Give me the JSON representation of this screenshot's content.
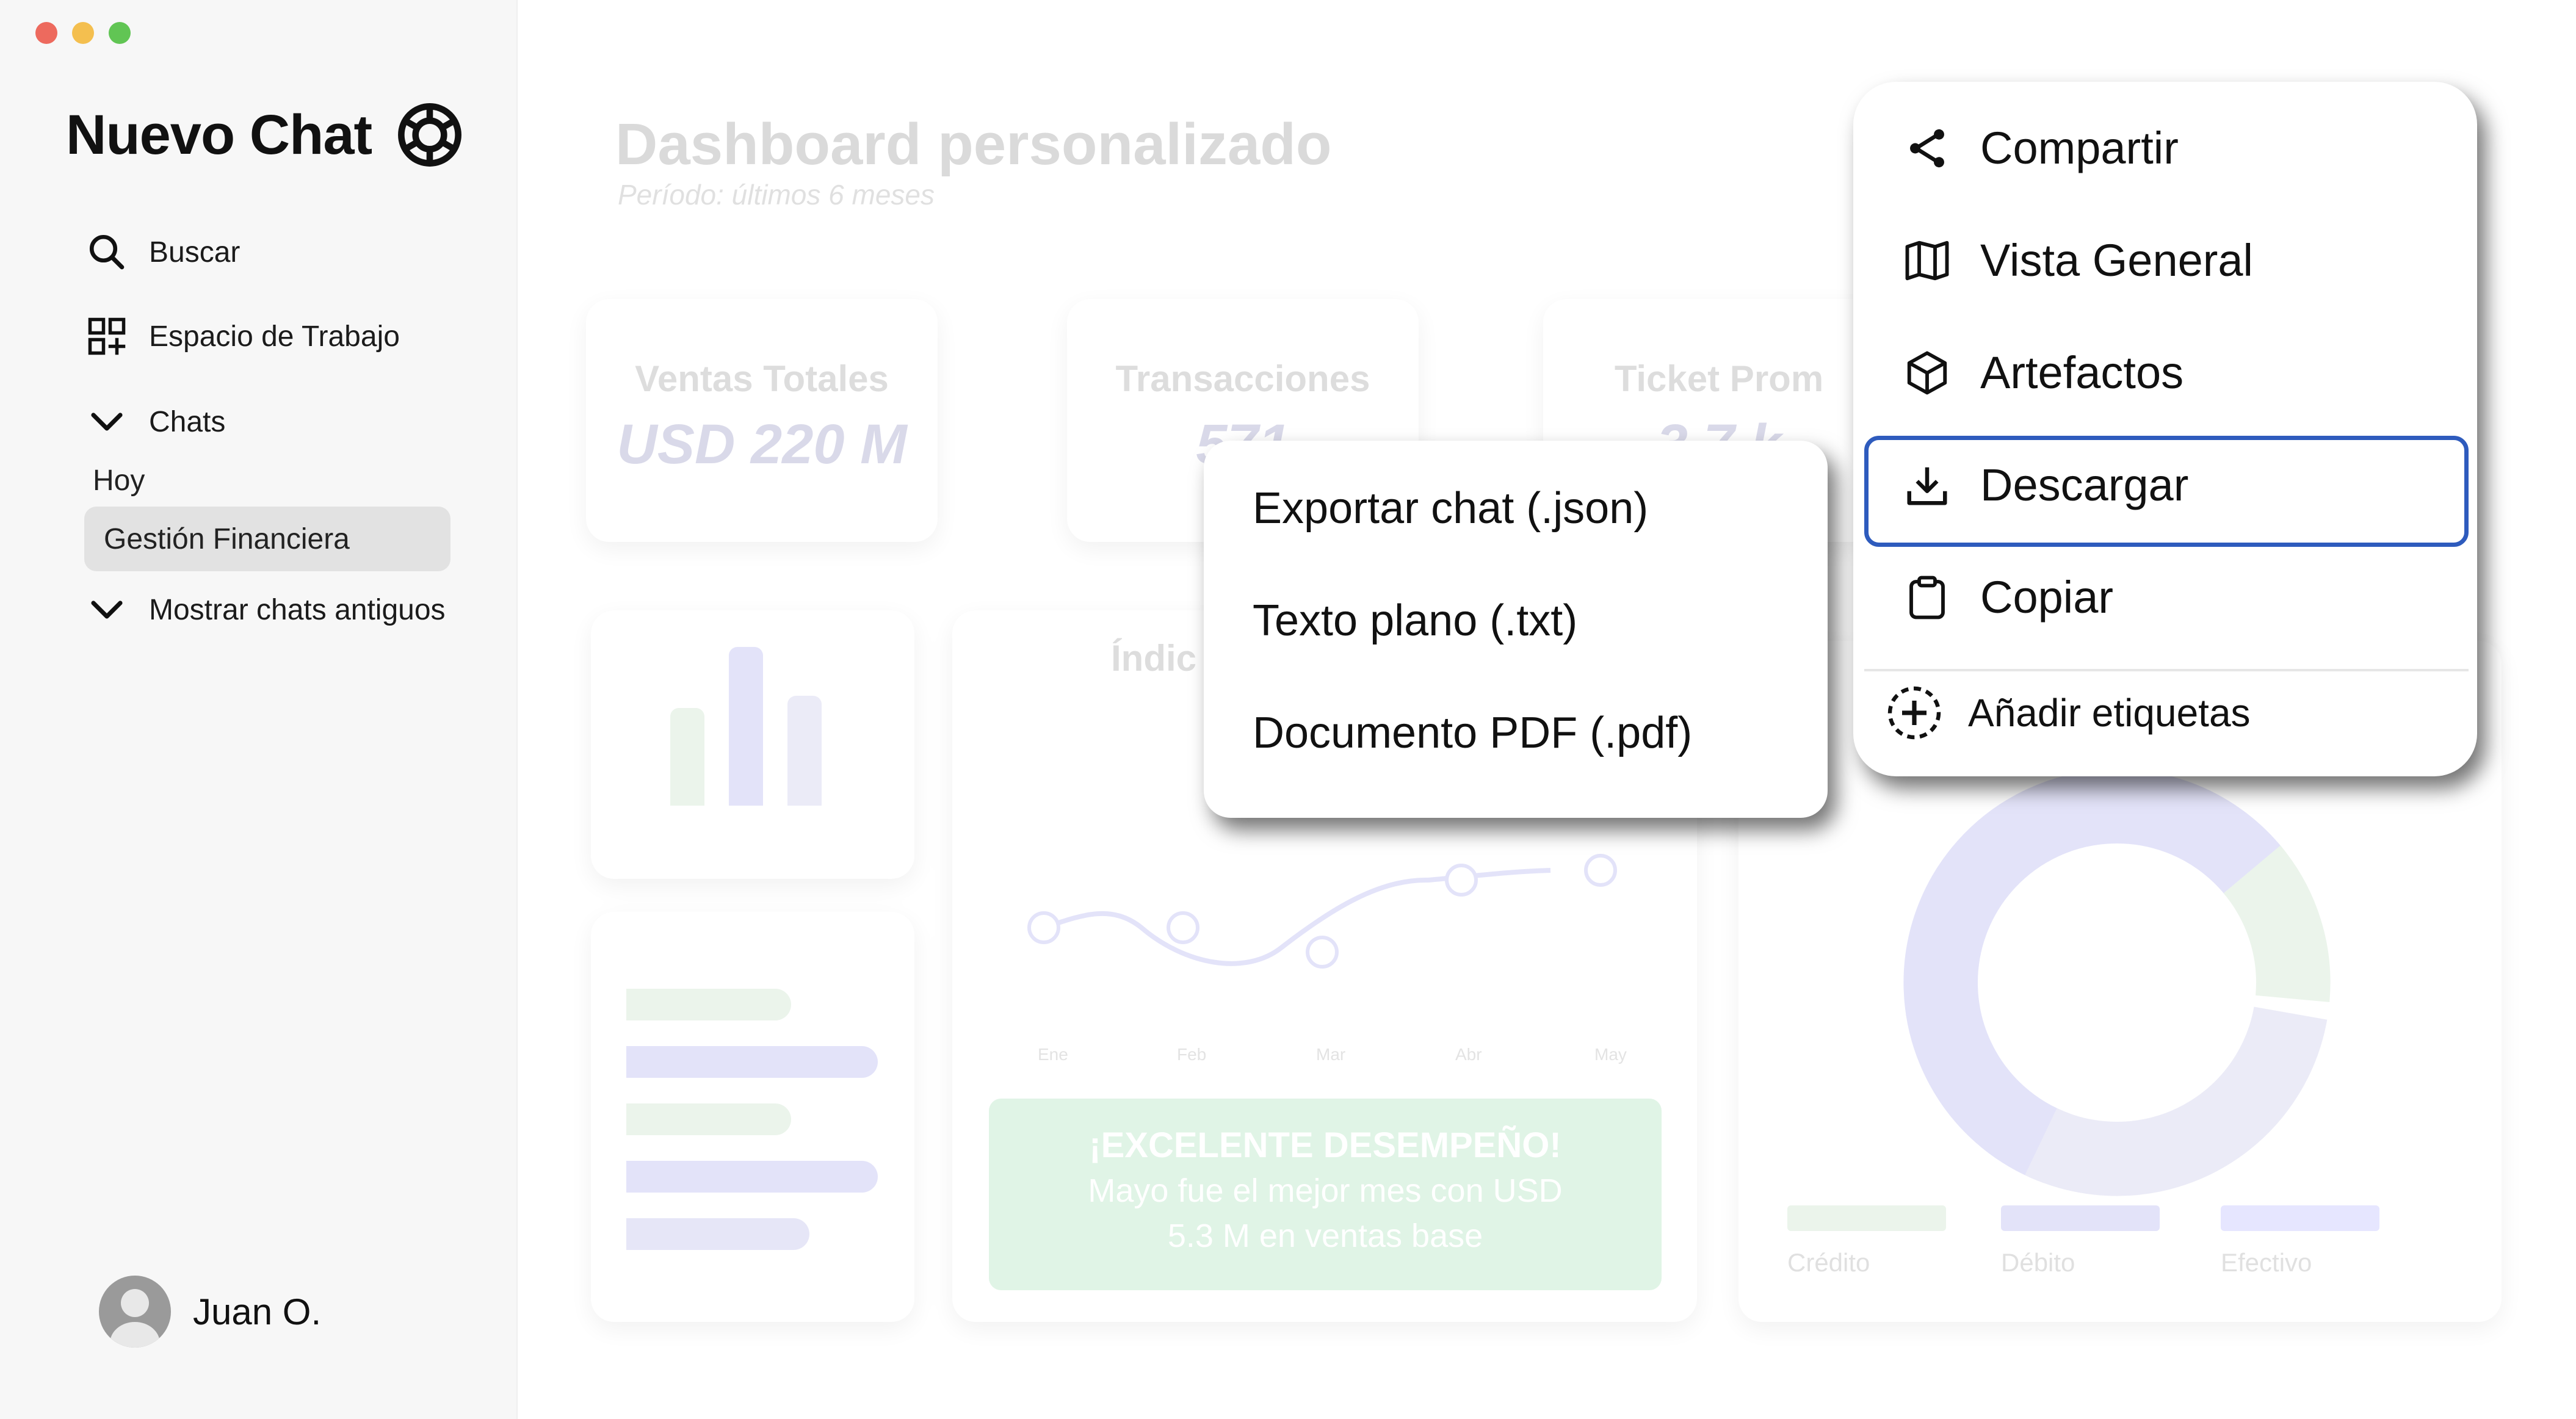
{
  "app": {
    "title": "Nuevo Chat"
  },
  "sidebar": {
    "search_label": "Buscar",
    "workspace_label": "Espacio de Trabajo",
    "chats_label": "Chats",
    "today_label": "Hoy",
    "active_chat": "Gestión Financiera",
    "older_chats_label": "Mostrar chats antiguos",
    "user_name": "Juan O."
  },
  "dashboard": {
    "title": "Dashboard personalizado",
    "subtitle": "Período: últimos 6 meses",
    "kpis": [
      {
        "label": "Ventas Totales",
        "value": "USD 220 M"
      },
      {
        "label": "Transacciones",
        "value": "571"
      },
      {
        "label": "Ticket Prom",
        "value": "3.7 k"
      }
    ],
    "line_card_title": "Índic",
    "months": [
      "Ene",
      "Feb",
      "Mar",
      "Abr",
      "May"
    ],
    "success_title": "¡EXCELENTE DESEMPEÑO!",
    "success_line1": "Mayo fue el mejor mes con USD",
    "success_line2": "5.3 M en ventas base",
    "legend": [
      "Crédito",
      "Débito",
      "Efectivo"
    ]
  },
  "menu": {
    "share_label": "Compartir",
    "overview_label": "Vista General",
    "artifacts_label": "Artefactos",
    "download_label": "Descargar",
    "copy_label": "Copiar",
    "add_tags_label": "Añadir etiquetas"
  },
  "download_submenu": {
    "items": [
      "Exportar chat (.json)",
      "Texto plano (.txt)",
      "Documento PDF (.pdf)"
    ]
  },
  "colors": {
    "highlight_border": "#2e5bbd",
    "success_green": "#45c16b",
    "accent_purple": "#5a5ae0"
  }
}
